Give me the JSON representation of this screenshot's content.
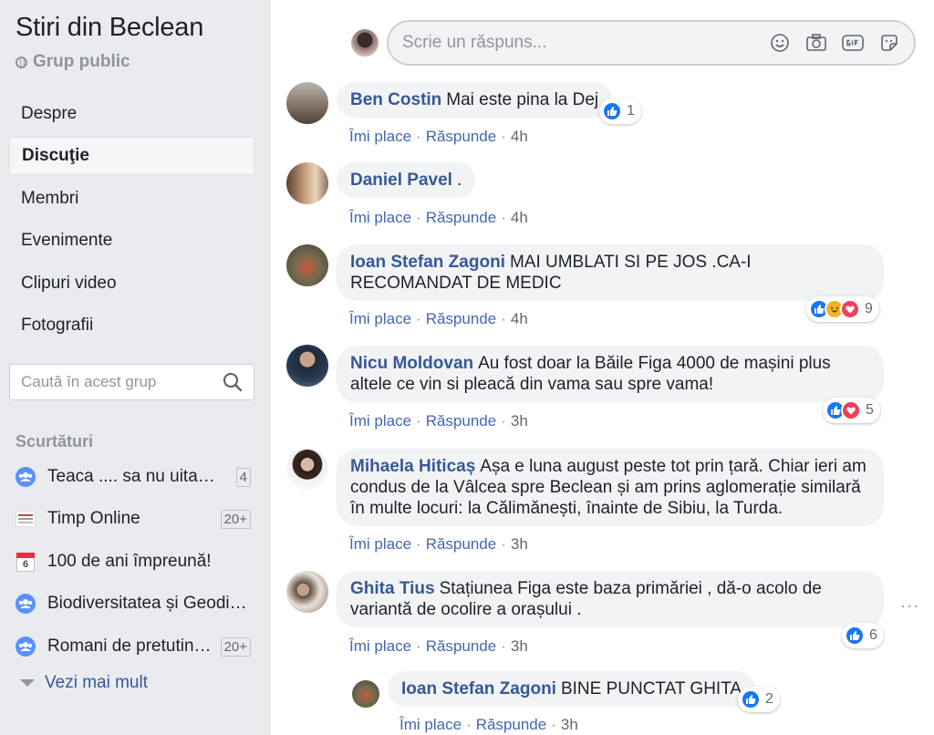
{
  "sidebar": {
    "group_name": "Stiri din Beclean",
    "group_type": "Grup public",
    "nav": [
      {
        "label": "Despre",
        "active": false
      },
      {
        "label": "Discuţie",
        "active": true
      },
      {
        "label": "Membri",
        "active": false
      },
      {
        "label": "Evenimente",
        "active": false
      },
      {
        "label": "Clipuri video",
        "active": false
      },
      {
        "label": "Fotografii",
        "active": false
      }
    ],
    "search_placeholder": "Caută în acest grup",
    "shortcuts_title": "Scurtături",
    "shortcuts": [
      {
        "label": "Teaca .... sa nu uita…",
        "badge": "4",
        "icon": "group-icon"
      },
      {
        "label": "Timp Online",
        "badge": "20+",
        "icon": "newspaper-icon"
      },
      {
        "label": "100 de ani împreună!",
        "badge": "",
        "icon": "calendar-icon",
        "cal_day": "6"
      },
      {
        "label": "Biodiversitatea și Geodi…",
        "badge": "",
        "icon": "group-icon"
      },
      {
        "label": "Romani de pretutin…",
        "badge": "20+",
        "icon": "group-icon"
      }
    ],
    "see_more": "Vezi mai mult"
  },
  "reply_box": {
    "placeholder": "Scrie un răspuns..."
  },
  "action_labels": {
    "like": "Îmi place",
    "reply": "Răspunde",
    "sep": "·"
  },
  "comments": [
    {
      "author": "Ben Costin",
      "text": "Mai este pina la Dej",
      "time": "4h",
      "reactions": [
        "like"
      ],
      "count": "1"
    },
    {
      "author": "Daniel Pavel",
      "text": ".",
      "time": "4h",
      "reactions": [],
      "count": ""
    },
    {
      "author": "Ioan Stefan Zagoni",
      "text": "MAI UMBLATI SI PE JOS .CA-I RECOMANDAT DE MEDIC",
      "time": "4h",
      "reactions": [
        "like",
        "haha",
        "love"
      ],
      "count": "9"
    },
    {
      "author": "Nicu Moldovan",
      "text": "Au fost doar la Băile Figa 4000 de mașini plus altele ce vin si pleacă din vama sau spre vama!",
      "time": "3h",
      "reactions": [
        "like",
        "love"
      ],
      "count": "5"
    },
    {
      "author": "Mihaela Hiticaș",
      "text": "Așa e luna august peste tot prin țară. Chiar ieri am condus de la Vâlcea spre Beclean și am prins aglomerație similară în multe locuri: la Călimănești, înainte de Sibiu, la Turda.",
      "time": "3h",
      "reactions": [],
      "count": ""
    },
    {
      "author": "Ghita Tius",
      "text": "Stațiunea Figa este baza primăriei , dă-o acolo de variantă de ocolire a orașului .",
      "time": "3h",
      "reactions": [
        "like"
      ],
      "count": "6"
    },
    {
      "author": "Ioan Stefan Zagoni",
      "text": "BINE PUNCTAT GHITA",
      "time": "3h",
      "reactions": [
        "like"
      ],
      "count": "2"
    }
  ],
  "more_options": "···",
  "colors": {
    "link": "#365899",
    "action": "#4267b2",
    "bubble": "#f2f3f5",
    "sidebar_bg": "#e9ebee",
    "like": "#1877f2",
    "love": "#f33e58",
    "haha": "#f7b125"
  }
}
